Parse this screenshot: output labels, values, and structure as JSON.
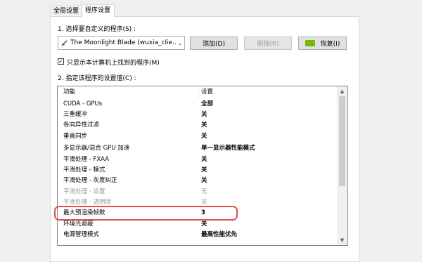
{
  "tabs": [
    {
      "label": "全局设置"
    },
    {
      "label": "程序设置"
    }
  ],
  "step1_label": "1. 选择要自定义的程序(S) :",
  "program_select": {
    "value": "The Moonlight Blade (wuxia_clie..."
  },
  "buttons": {
    "add": "添加(D)",
    "delete": "删除(R)",
    "restore": "恢复(I)"
  },
  "checkbox": {
    "label": "只显示本计算机上找到的程序(M)",
    "checked": "✓"
  },
  "step2_label": "2. 指定该程序的设置值(C) :",
  "table": {
    "headers": {
      "feature": "功能",
      "setting": "设置"
    },
    "rows": [
      {
        "feature": "CUDA - GPUs",
        "setting": "全部"
      },
      {
        "feature": "三重缓冲",
        "setting": "关"
      },
      {
        "feature": "各向异性过滤",
        "setting": "关"
      },
      {
        "feature": "垂直同步",
        "setting": "关"
      },
      {
        "feature": "多显示器/混合 GPU 加速",
        "setting": "单一显示器性能模式"
      },
      {
        "feature": "平滑处理 - FXAA",
        "setting": "关"
      },
      {
        "feature": "平滑处理 - 模式",
        "setting": "关"
      },
      {
        "feature": "平滑处理 - 灰度纠正",
        "setting": "关"
      },
      {
        "feature": "平滑处理 - 设置",
        "setting": "无"
      },
      {
        "feature": "平滑处理 - 透明度",
        "setting": "关"
      },
      {
        "feature": "最大预渲染帧数",
        "setting": "3"
      },
      {
        "feature": "环境光遮蔽",
        "setting": "关"
      },
      {
        "feature": "电源管理模式",
        "setting": "最高性能优先"
      }
    ]
  },
  "colors": {
    "highlight": "#e0514f",
    "nvidia": "#76b900"
  }
}
